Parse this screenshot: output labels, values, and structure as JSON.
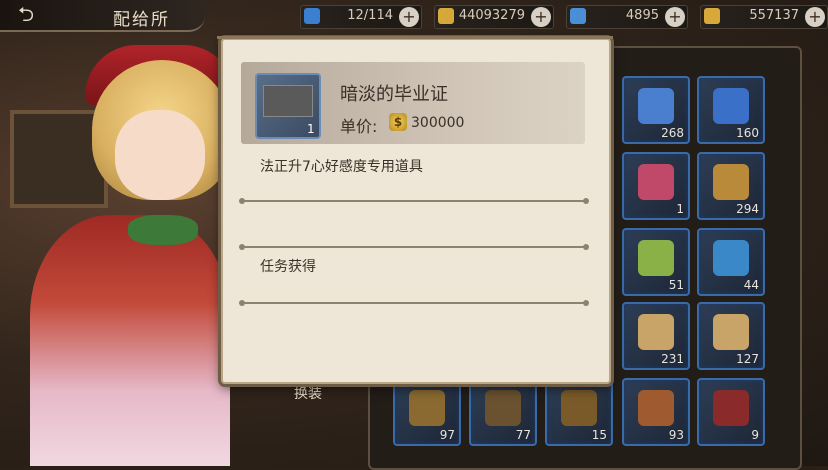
{
  "header": {
    "title": "配给所",
    "back_icon": "back-arrow-icon"
  },
  "resources": [
    {
      "icon": "stamina-icon",
      "value": "12/114",
      "color": "#3b7fd0"
    },
    {
      "icon": "gold-coin-icon",
      "value": "44093279",
      "color": "#d4a93a"
    },
    {
      "icon": "crystal-icon",
      "value": "4895",
      "color": "#4a8ed6"
    },
    {
      "icon": "badge-icon",
      "value": "557137",
      "color": "#d8a83a"
    }
  ],
  "inventory": {
    "slots": [
      {
        "icon": "potion-icon",
        "count": "268",
        "color": "#4a7fd0"
      },
      {
        "icon": "potion-bottle-icon",
        "count": "160",
        "color": "#3b70c8"
      },
      {
        "icon": "ribbon-icon",
        "count": "1",
        "color": "#c04868"
      },
      {
        "icon": "treasure-pile-icon",
        "count": "294",
        "color": "#b88a3a"
      },
      {
        "icon": "stick-icon",
        "count": "51",
        "color": "#8ab048"
      },
      {
        "icon": "jar-icon",
        "count": "44",
        "color": "#3a88c8"
      },
      {
        "icon": "scroll-icon",
        "count": "231",
        "color": "#c8a468"
      },
      {
        "icon": "scroll-icon",
        "count": "127",
        "color": "#c8a468"
      },
      {
        "icon": "book-icon",
        "count": "97",
        "color": "#8a6a30"
      },
      {
        "icon": "book-icon",
        "count": "77",
        "color": "#6a5230"
      },
      {
        "icon": "frame-icon",
        "count": "15",
        "color": "#7a5a28"
      },
      {
        "icon": "ornate-box-icon",
        "count": "93",
        "color": "#a05a30"
      },
      {
        "icon": "turkey-icon",
        "count": "9",
        "color": "#8a2a2a"
      }
    ]
  },
  "equip_label": "换装",
  "popup": {
    "item_name": "暗淡的毕业证",
    "item_count": "1",
    "price_label": "单价:",
    "price_value": "300000",
    "description": "法正升7心好感度专用道具",
    "source": "任务获得"
  }
}
